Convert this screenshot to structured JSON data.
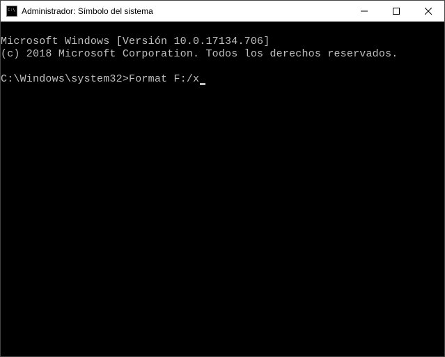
{
  "window": {
    "title": "Administrador: Símbolo del sistema"
  },
  "terminal": {
    "line1": "Microsoft Windows [Versión 10.0.17134.706]",
    "line2": "(c) 2018 Microsoft Corporation. Todos los derechos reservados.",
    "blank": "",
    "prompt": "C:\\Windows\\system32>",
    "command": "Format F:/x"
  }
}
